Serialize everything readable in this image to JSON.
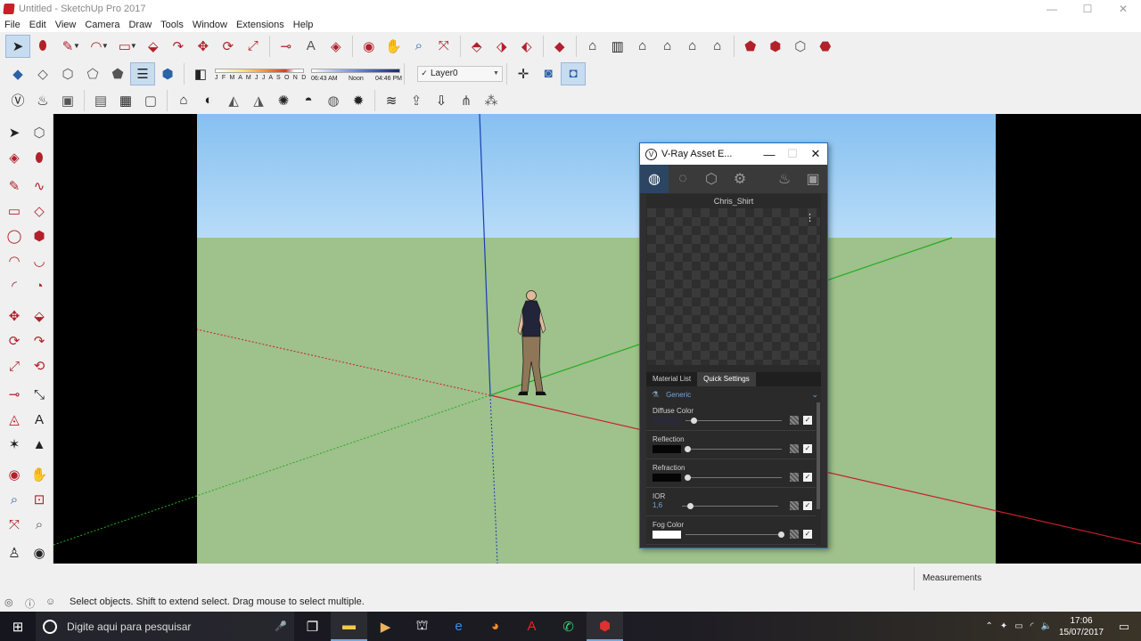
{
  "window": {
    "title": "Untitled - SketchUp Pro 2017",
    "minimize": "—",
    "maximize": "☐",
    "close": "✕"
  },
  "menu": [
    "File",
    "Edit",
    "View",
    "Camera",
    "Draw",
    "Tools",
    "Window",
    "Extensions",
    "Help"
  ],
  "toolbar": {
    "shadow_months": "J F M A M J J A S O N D",
    "time_start": "06:43 AM",
    "time_noon": "Noon",
    "time_end": "04:46 PM",
    "layer_check": "✓",
    "layer": "Layer0"
  },
  "vray": {
    "title": "V-Ray Asset E...",
    "material_name": "Chris_Shirt",
    "kebab": "⋮",
    "tab_material_list": "Material List",
    "tab_quick_settings": "Quick Settings",
    "material_type": "Generic",
    "params": [
      {
        "label": "Diffuse Color",
        "swatch_color": "#2a2a36",
        "slider": 0.08
      },
      {
        "label": "Reflection",
        "swatch_color": "#050505",
        "slider": 0.02
      },
      {
        "label": "Refraction",
        "swatch_color": "#050505",
        "slider": 0.02
      },
      {
        "label": "IOR",
        "value": "1,6",
        "slider": 0.08
      },
      {
        "label": "Fog Color",
        "swatch_color": "#ffffff",
        "slider": 0.99
      }
    ],
    "checkbox": "✓"
  },
  "status": {
    "measurements_label": "Measurements",
    "hint": "Select objects. Shift to extend select. Drag mouse to select multiple."
  },
  "taskbar": {
    "search_placeholder": "Digite aqui para pesquisar",
    "time": "17:06",
    "date": "15/07/2017"
  },
  "colors": {
    "accent": "#1c6bbf",
    "sky": "#86c0f0",
    "ground": "#9fc18c",
    "red_axis": "#c8202a",
    "green_axis": "#1fae1f",
    "blue_axis": "#1a3fb0"
  }
}
